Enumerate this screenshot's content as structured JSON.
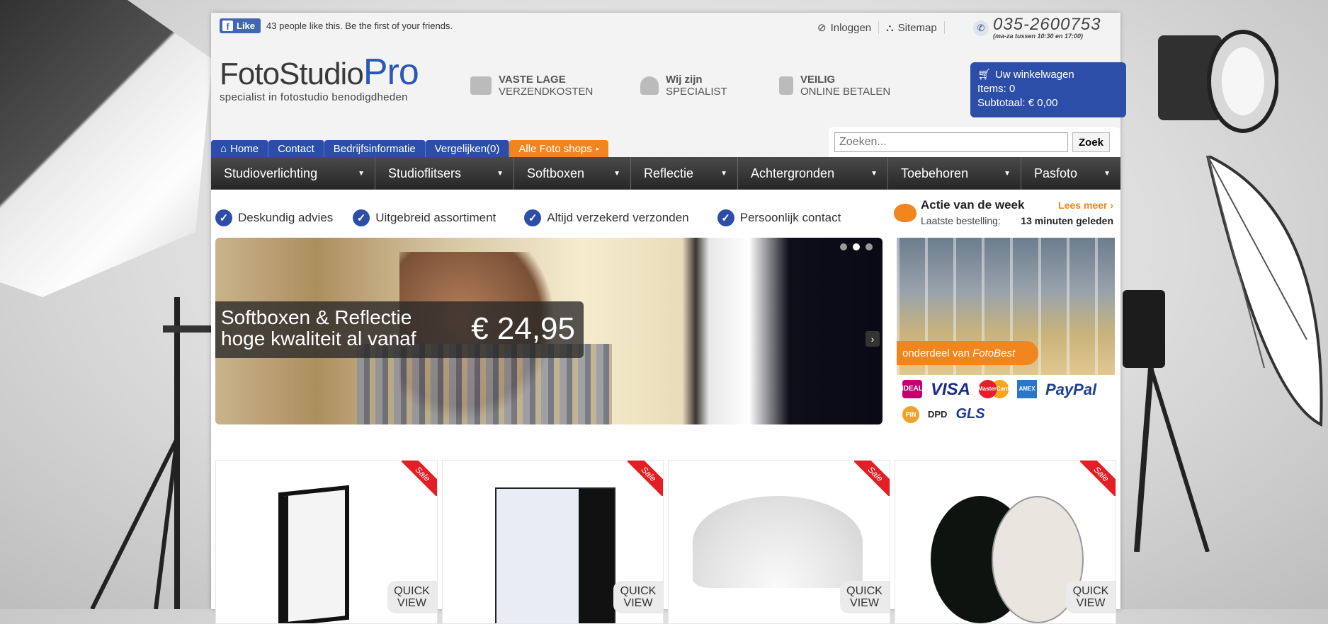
{
  "facebook": {
    "like_label": "Like",
    "like_text": "43 people like this. Be the first of your friends."
  },
  "header": {
    "login_label": "Inloggen",
    "sitemap_label": "Sitemap",
    "phone": "035-2600753",
    "phone_hours": "(ma-za tussen 10:30 en 17:00)",
    "logo_main": "FotoStudio",
    "logo_pro": "Pro",
    "logo_tagline": "specialist in fotostudio benodigdheden",
    "usps": [
      {
        "line1": "VASTE LAGE",
        "line2": "VERZENDKOSTEN"
      },
      {
        "line1": "Wij zijn",
        "line2": "SPECIALIST"
      },
      {
        "line1": "VEILIG",
        "line2": "ONLINE BETALEN"
      }
    ]
  },
  "cart": {
    "title": "Uw winkelwagen",
    "items": "Items: 0",
    "subtotal": "Subtotaal: € 0,00"
  },
  "tabs": [
    {
      "label": "Home"
    },
    {
      "label": "Contact"
    },
    {
      "label": "Bedrijfsinformatie"
    },
    {
      "label": "Vergelijken(0)"
    },
    {
      "label": "Alle Foto shops"
    }
  ],
  "search": {
    "placeholder": "Zoeken...",
    "button": "Zoek"
  },
  "menu": [
    "Studioverlichting",
    "Studioflitsers",
    "Softboxen",
    "Reflectie",
    "Achtergronden",
    "Toebehoren",
    "Pasfoto"
  ],
  "checks": [
    "Deskundig advies",
    "Uitgebreid assortiment",
    "Altijd verzekerd verzonden",
    "Persoonlijk contact"
  ],
  "slider": {
    "line1": "Softboxen & Reflectie",
    "line2": "hoge kwaliteit al vanaf",
    "price": "€ 24,95"
  },
  "actie": {
    "title": "Actie van de week",
    "more": "Lees meer",
    "last_order_label": "Laatste bestelling:",
    "last_order_value": "13 minuten geleden"
  },
  "promo": {
    "label": "onderdeel van",
    "brand": "FotoBest"
  },
  "payments": [
    "iDEAL",
    "VISA",
    "MasterCard",
    "AMEX",
    "PayPal",
    "PIN",
    "DPD",
    "GLS"
  ],
  "products": [
    {
      "badge": "Sale",
      "quick": "QUICK VIEW"
    },
    {
      "badge": "Sale",
      "quick": "QUICK VIEW"
    },
    {
      "badge": "Sale",
      "quick": "QUICK VIEW"
    },
    {
      "badge": "Sale",
      "quick": "QUICK VIEW"
    }
  ],
  "colors": {
    "brand_blue": "#2c4ea8",
    "accent_orange": "#f2851e",
    "sale_red": "#e31e24"
  }
}
